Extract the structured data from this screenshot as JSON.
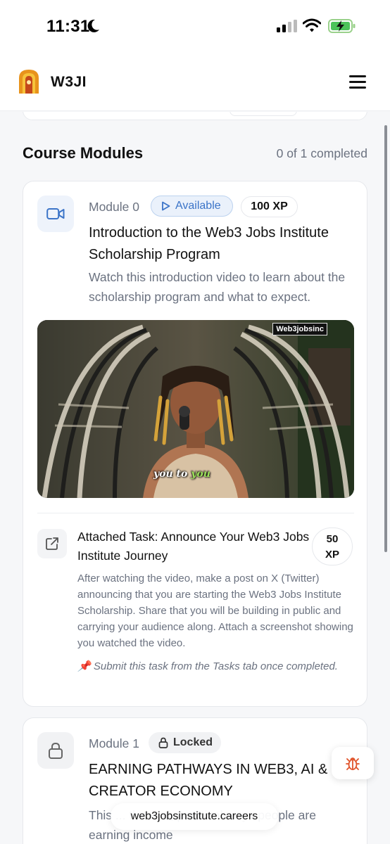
{
  "status_bar": {
    "time": "11:31"
  },
  "header": {
    "brand": "W3JI"
  },
  "section": {
    "title": "Course Modules",
    "progress": "0 of 1 completed"
  },
  "modules": [
    {
      "label": "Module 0",
      "status": "Available",
      "xp": "100 XP",
      "title": "Introduction to the Web3 Jobs Institute Scholarship Program",
      "description": "Watch this introduction video to learn about the scholarship program and what to expect.",
      "video": {
        "tag": "Web3jobsinc",
        "caption_plain": "you to ",
        "caption_highlight": "you"
      },
      "task": {
        "title": "Attached Task: Announce Your Web3 Jobs Institute Journey",
        "xp_value": "50",
        "xp_unit": "XP",
        "description": "After watching the video, make a post on X (Twitter) announcing that you are starting the Web3 Jobs Institute Scholarship. Share that you will be building in public and carrying your audience along. Attach a screenshot showing you watched the video.",
        "note": "📌 Submit this task from the Tasks tab once completed."
      }
    },
    {
      "label": "Module 1",
      "status": "Locked",
      "title": "EARNING PATHWAYS IN WEB3, AI & CREATOR ECONOMY",
      "description": "This ... the real, practical ways people are earning income"
    }
  ],
  "browser": {
    "url": "web3jobsinstitute.careers"
  },
  "colors": {
    "accent_blue": "#3b74c8",
    "badge_blue_bg": "#eaf1fb",
    "bug_orange": "#e0542b",
    "logo_orange": "#e8931c"
  },
  "icons": [
    "moon-icon",
    "signal-icon",
    "wifi-icon",
    "battery-charging-icon",
    "w3ji-logo",
    "menu-icon",
    "video-camera-icon",
    "play-icon",
    "external-link-icon",
    "lock-icon",
    "bug-icon"
  ]
}
